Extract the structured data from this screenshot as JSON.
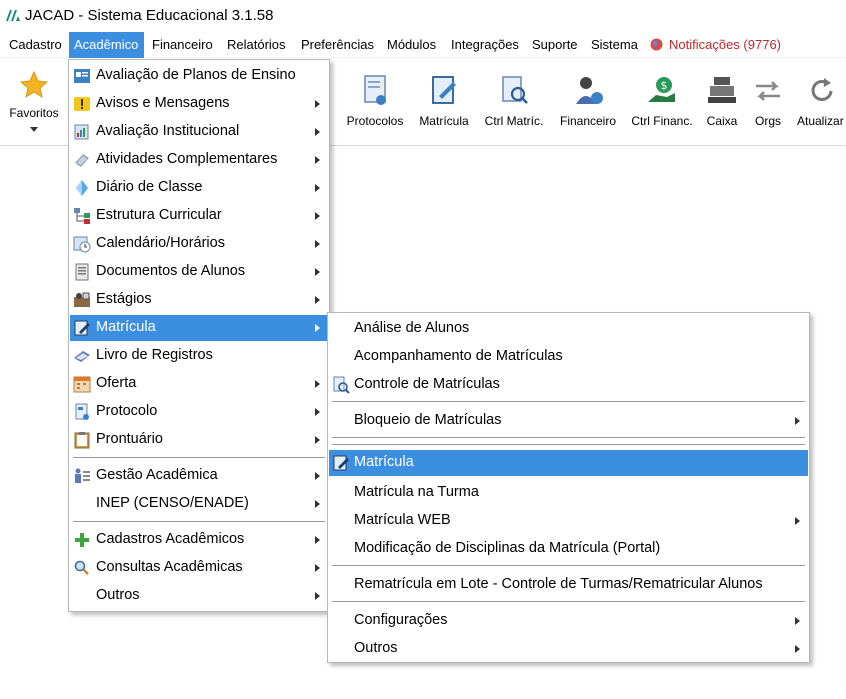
{
  "window": {
    "title": "JACAD - Sistema Educacional 3.1.58"
  },
  "menubar": {
    "items": [
      "Cadastro",
      "Acadêmico",
      "Financeiro",
      "Relatórios",
      "Preferências",
      "Módulos",
      "Integrações",
      "Suporte",
      "Sistema"
    ],
    "active_index": 1,
    "notifications": "Notificações (9776)"
  },
  "toolbar": {
    "favoritos": "Favoritos",
    "buttons": [
      "Protocolos",
      "Matrícula",
      "Ctrl Matríc.",
      "Financeiro",
      "Ctrl Financ.",
      "Caixa",
      "Orgs",
      "Atualizar"
    ]
  },
  "academico_menu": {
    "items": [
      {
        "label": "Avaliação de Planos de Ensino",
        "icon": "planos-icon"
      },
      {
        "label": "Avisos e Mensagens",
        "icon": "avisos-icon"
      },
      {
        "label": "Avaliação Institucional",
        "icon": "avaliacao-icon"
      },
      {
        "label": "Atividades Complementares",
        "icon": "atividades-icon"
      },
      {
        "label": "Diário de Classe",
        "icon": "diario-icon"
      },
      {
        "label": "Estrutura Curricular",
        "icon": "estrutura-icon"
      },
      {
        "label": "Calendário/Horários",
        "icon": "calendario-icon"
      },
      {
        "label": "Documentos de Alunos",
        "icon": "documentos-icon"
      },
      {
        "label": "Estágios",
        "icon": "estagios-icon"
      },
      {
        "label": "Matrícula",
        "icon": "matricula-icon"
      },
      {
        "label": "Livro de Registros",
        "icon": "livro-icon"
      },
      {
        "label": "Oferta",
        "icon": "oferta-icon"
      },
      {
        "label": "Protocolo",
        "icon": "protocolo-icon"
      },
      {
        "label": "Prontuário",
        "icon": "prontuario-icon"
      },
      {
        "label": "Gestão Acadêmica",
        "icon": "gestao-icon"
      },
      {
        "label": "INEP (CENSO/ENADE)",
        "icon": ""
      },
      {
        "label": "Cadastros Acadêmicos",
        "icon": "plus-icon"
      },
      {
        "label": "Consultas Acadêmicas",
        "icon": "search-icon"
      },
      {
        "label": "Outros",
        "icon": ""
      }
    ]
  },
  "matricula_submenu": {
    "items": [
      {
        "label": "Análise de Alunos"
      },
      {
        "label": "Acompanhamento de Matrículas"
      },
      {
        "label": "Controle de Matrículas"
      },
      {
        "label": "Bloqueio de Matrículas"
      },
      {
        "label": "Matrícula"
      },
      {
        "label": "Matrícula na Turma"
      },
      {
        "label": "Matrícula WEB"
      },
      {
        "label": "Modificação de Disciplinas da Matrícula (Portal)"
      },
      {
        "label": "Rematrícula em Lote - Controle de Turmas/Rematricular Alunos"
      },
      {
        "label": "Configurações"
      },
      {
        "label": "Outros"
      }
    ]
  },
  "colors": {
    "highlight": "#3c8fe0",
    "notification": "#c0282d",
    "brand": "#1a8a7a"
  }
}
